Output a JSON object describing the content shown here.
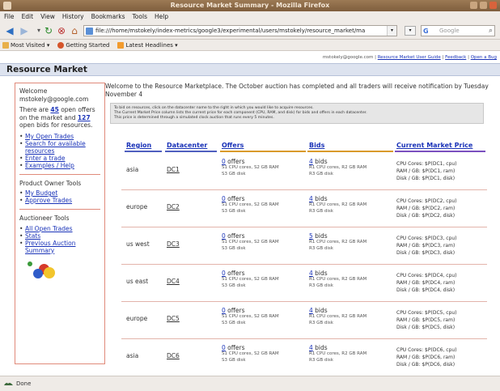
{
  "window": {
    "title": "Resource Market Summary - Mozilla Firefox"
  },
  "menu": [
    "File",
    "Edit",
    "View",
    "History",
    "Bookmarks",
    "Tools",
    "Help"
  ],
  "url": "file:///home/mstokely/index-metrics/google3/experimental/users/mstokely/resource_market/ma",
  "search_placeholder": "Google",
  "bookmarks": [
    "Most Visited ▾",
    "Getting Started",
    "Latest Headlines ▾"
  ],
  "page": {
    "user_line": {
      "email": "mstokely@google.com",
      "links": [
        "Resource Market User Guide",
        "Feedback",
        "Open a Bug"
      ]
    },
    "heading": "Resource Market",
    "sidebar": {
      "welcome": "Welcome mstokely@google.com",
      "offers_pre": "There are ",
      "offers_count": "45",
      "offers_mid": " open offers on the market and ",
      "bids_count": "127",
      "bids_post": " open bids for resources.",
      "links_main": [
        "My Open Trades",
        "Search for available resources",
        "Enter a trade",
        "Examples / Help"
      ],
      "owner_title": "Product Owner Tools",
      "links_owner": [
        "My Budget",
        "Approve Trades"
      ],
      "auctioneer_title": "Auctioneer Tools",
      "links_auctioneer": [
        "All Open Trades",
        "Stats",
        "Previous Auction Summary"
      ]
    },
    "intro": "Welcome to the Resource Marketplace. The October auction has completed and all traders will receive notification by Tuesday November 4",
    "info": [
      "To bid on resources, click on the datacenter name to the right in which you would like to acquire resources.",
      "The Current Market Price column lists the current price for each component (CPU, RAM, and disk) for bids and offers in each datacenter.",
      "This price is determined through a simulated clock auction that runs every 5 minutes."
    ],
    "table": {
      "headers": [
        "Region",
        "Datacenter",
        "Offers",
        "Bids",
        "Current Market Price"
      ],
      "rows": [
        {
          "region": "asia",
          "dc": "DC1",
          "offers_n": "0",
          "bids_n": "4",
          "offers_l1": "S1 CPU cores, S2 GB RAM",
          "offers_l2": "S3 GB disk",
          "bids_l1": "R1 CPU cores, R2 GB RAM",
          "bids_l2": "R3 GB disk",
          "p_cpu": "CPU Cores: $P(DC1, cpu)",
          "p_ram": "RAM / GB: $P(DC1, ram)",
          "p_disk": "Disk / GB: $P(DC1, disk)"
        },
        {
          "region": "europe",
          "dc": "DC2",
          "offers_n": "0",
          "bids_n": "4",
          "offers_l1": "S1 CPU cores, S2 GB RAM",
          "offers_l2": "S3 GB disk",
          "bids_l1": "R1 CPU cores, R2 GB RAM",
          "bids_l2": "R3 GB disk",
          "p_cpu": "CPU Cores: $P(DC2, cpu)",
          "p_ram": "RAM / GB: $P(DC2, ram)",
          "p_disk": "Disk / GB: $P(DC2, disk)"
        },
        {
          "region": "us west",
          "dc": "DC3",
          "offers_n": "0",
          "bids_n": "5",
          "offers_l1": "S1 CPU cores, S2 GB RAM",
          "offers_l2": "S3 GB disk",
          "bids_l1": "R1 CPU cores, R2 GB RAM",
          "bids_l2": "R3 GB disk",
          "p_cpu": "CPU Cores: $P(DC3, cpu)",
          "p_ram": "RAM / GB: $P(DC3, ram)",
          "p_disk": "Disk / GB: $P(DC3, disk)"
        },
        {
          "region": "us east",
          "dc": "DC4",
          "offers_n": "0",
          "bids_n": "4",
          "offers_l1": "S1 CPU cores, S2 GB RAM",
          "offers_l2": "S3 GB disk",
          "bids_l1": "R1 CPU cores, R2 GB RAM",
          "bids_l2": "R3 GB disk",
          "p_cpu": "CPU Cores: $P(DC4, cpu)",
          "p_ram": "RAM / GB: $P(DC4, ram)",
          "p_disk": "Disk / GB: $P(DC4, disk)"
        },
        {
          "region": "europe",
          "dc": "DC5",
          "offers_n": "0",
          "bids_n": "4",
          "offers_l1": "S1 CPU cores, S2 GB RAM",
          "offers_l2": "S3 GB disk",
          "bids_l1": "R1 CPU cores, R2 GB RAM",
          "bids_l2": "R3 GB disk",
          "p_cpu": "CPU Cores: $P(DC5, cpu)",
          "p_ram": "RAM / GB: $P(DC5, ram)",
          "p_disk": "Disk / GB: $P(DC5, disk)"
        },
        {
          "region": "asia",
          "dc": "DC6",
          "offers_n": "0",
          "bids_n": "4",
          "offers_l1": "S1 CPU cores, S2 GB RAM",
          "offers_l2": "S3 GB disk",
          "bids_l1": "R1 CPU cores, R2 GB RAM",
          "bids_l2": "R3 GB disk",
          "p_cpu": "CPU Cores: $P(DC6, cpu)",
          "p_ram": "RAM / GB: $P(DC6, ram)",
          "p_disk": "Disk / GB: $P(DC6, disk)"
        }
      ],
      "offers_word": "offers",
      "bids_word": "bids"
    }
  },
  "status": "Done",
  "colors": {
    "accent_link": "#1a33b8",
    "sidebar_border": "#e08a7a",
    "header_bg": "#dde3ef",
    "col_region": "#4f5fbf",
    "col_dc": "#4f5fbf",
    "col_offers": "#d99a2b",
    "col_bids": "#d99a2b",
    "col_price": "#7a4fbf"
  }
}
